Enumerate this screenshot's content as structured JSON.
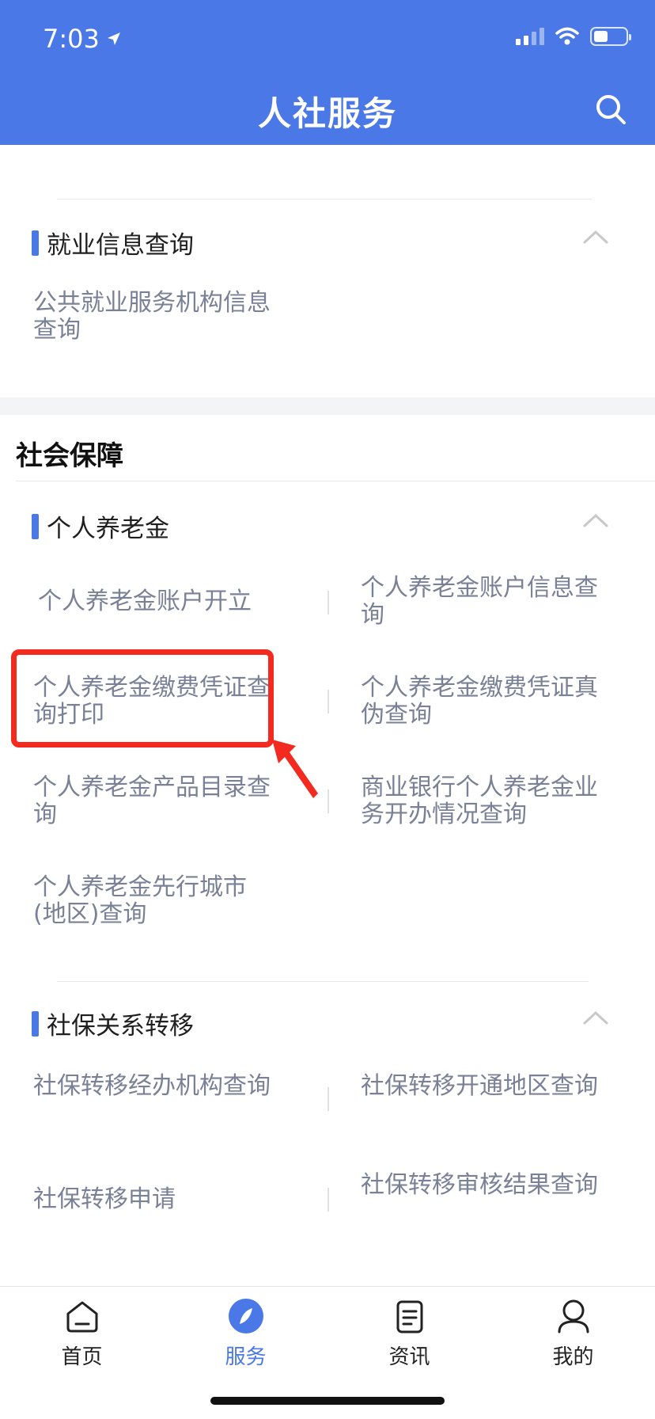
{
  "status_bar": {
    "time": "7:03"
  },
  "header": {
    "title": "人社服务"
  },
  "employment_group": {
    "title": "就业信息查询",
    "items": [
      "公共就业服务机构信息查询"
    ]
  },
  "social_security": {
    "section_title": "社会保障",
    "pension_group": {
      "title": "个人养老金",
      "items": [
        "个人养老金账户开立",
        "个人养老金账户信息查询",
        "个人养老金缴费凭证查询打印",
        "个人养老金缴费凭证真伪查询",
        "个人养老金产品目录查询",
        "商业银行个人养老金业务开办情况查询",
        "个人养老金先行城市(地区)查询"
      ]
    },
    "transfer_group": {
      "title": "社保关系转移",
      "items": [
        "社保转移经办机构查询",
        "社保转移开通地区查询",
        "社保转移申请",
        "社保转移审核结果查询"
      ]
    }
  },
  "tabbar": {
    "tabs": [
      {
        "label": "首页",
        "icon": "home-icon"
      },
      {
        "label": "服务",
        "icon": "compass-icon",
        "active": true
      },
      {
        "label": "资讯",
        "icon": "news-icon"
      },
      {
        "label": "我的",
        "icon": "user-icon"
      }
    ]
  },
  "colors": {
    "brand": "#4a78e6",
    "highlight": "#f22a1f",
    "item_text": "#7a8196"
  }
}
